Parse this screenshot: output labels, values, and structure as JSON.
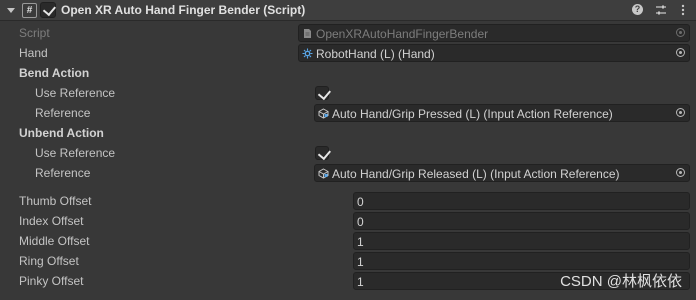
{
  "header": {
    "title": "Open XR Auto Hand Finger Bender (Script)",
    "enabled": true,
    "icons": [
      "foldout-arrow-icon",
      "script-icon",
      "help-icon",
      "preset-icon",
      "menu-kebab-icon"
    ]
  },
  "fields": {
    "script": {
      "label": "Script",
      "value": "OpenXRAutoHandFingerBender",
      "icon": "script-file-icon"
    },
    "hand": {
      "label": "Hand",
      "value": "RobotHand (L) (Hand)",
      "icon": "hand-component-icon"
    },
    "bend_action": {
      "header": "Bend Action",
      "use_reference_label": "Use Reference",
      "use_reference": true,
      "reference_label": "Reference",
      "reference_value": "Auto Hand/Grip Pressed (L) (Input Action Reference)",
      "icon": "input-action-icon"
    },
    "unbend_action": {
      "header": "Unbend Action",
      "use_reference_label": "Use Reference",
      "use_reference": true,
      "reference_label": "Reference",
      "reference_value": "Auto Hand/Grip Released (L) (Input Action Reference)",
      "icon": "input-action-icon"
    },
    "offsets": [
      {
        "label": "Thumb Offset",
        "value": "0"
      },
      {
        "label": "Index Offset",
        "value": "0"
      },
      {
        "label": "Middle Offset",
        "value": "1"
      },
      {
        "label": "Ring Offset",
        "value": "1"
      },
      {
        "label": "Pinky Offset",
        "value": "1"
      }
    ]
  },
  "watermark": "CSDN @林枫依依",
  "colors": {
    "background": "#383838",
    "field": "#2a2a2a",
    "text": "#c4c4c4",
    "disabled_text": "#7d7d7d"
  }
}
